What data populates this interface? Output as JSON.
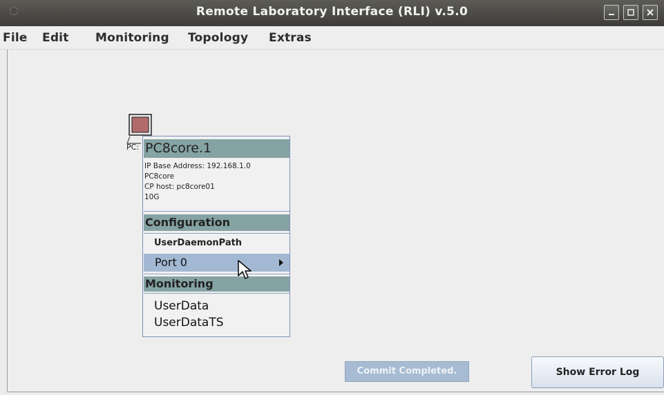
{
  "window": {
    "title": "Remote Laboratory Interface (RLI) v.5.0"
  },
  "menubar": {
    "items": [
      "File",
      "Edit",
      "Monitoring",
      "Topology",
      "Extras"
    ]
  },
  "node": {
    "label": "PC:",
    "icon": "computer-icon"
  },
  "popup": {
    "title": "PC8core.1",
    "info": [
      "IP Base Address: 192.168.1.0",
      "PC8core",
      "CP host: pc8core01",
      "10G"
    ],
    "config_header": "Configuration",
    "config_items": [
      "UserDaemonPath"
    ],
    "port_item": "Port 0",
    "monitoring_header": "Monitoring",
    "monitoring_items": [
      "UserData",
      "UserDataTS"
    ]
  },
  "status": {
    "text": "Commit Completed."
  },
  "error_log_button": "Show Error Log",
  "colors": {
    "titlebar": "#45443f",
    "popup_header": "#85a3a3",
    "selected_row": "#a3b8d2",
    "node_fill": "#b26b6b"
  }
}
